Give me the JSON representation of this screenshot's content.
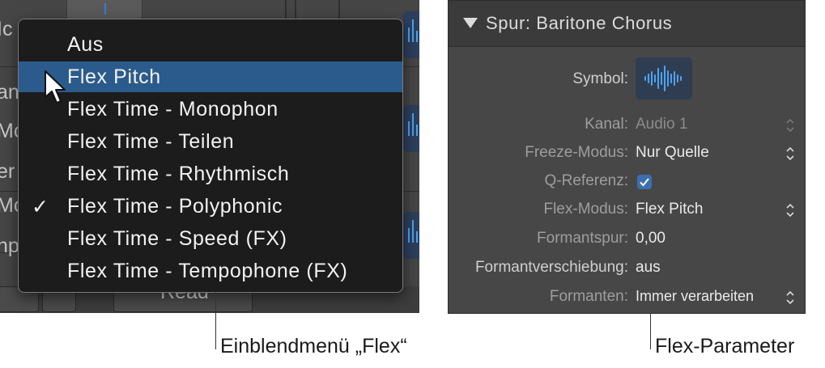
{
  "background_labels": [
    "Ic",
    "an",
    "Mc",
    "er",
    "Mc",
    "np"
  ],
  "background_read": "Read",
  "flex_menu": {
    "items": [
      {
        "label": "Aus",
        "checked": false,
        "selected": false
      },
      {
        "label": "Flex Pitch",
        "checked": false,
        "selected": true
      },
      {
        "label": "Flex Time - Monophon",
        "checked": false,
        "selected": false
      },
      {
        "label": "Flex Time - Teilen",
        "checked": false,
        "selected": false
      },
      {
        "label": "Flex Time - Rhythmisch",
        "checked": false,
        "selected": false
      },
      {
        "label": "Flex Time - Polyphonic",
        "checked": true,
        "selected": false
      },
      {
        "label": "Flex Time - Speed (FX)",
        "checked": false,
        "selected": false
      },
      {
        "label": "Flex Time - Tempophone (FX)",
        "checked": false,
        "selected": false
      }
    ],
    "checkmark": "✓"
  },
  "inspector": {
    "header": "Spur:  Baritone Chorus",
    "symbol_label": "Symbol:",
    "rows": [
      {
        "label": "Kanal:",
        "value": "Audio 1",
        "dim": true,
        "stepper": true
      },
      {
        "label": "Freeze-Modus:",
        "value": "Nur Quelle",
        "dim": false,
        "stepper": true
      },
      {
        "label": "Q-Referenz:",
        "value": "",
        "dim": false,
        "stepper": false,
        "checkbox": true
      },
      {
        "label": "Flex-Modus:",
        "value": "Flex Pitch",
        "dim": false,
        "stepper": true
      },
      {
        "label": "Formantspur:",
        "value": "0,00",
        "dim": false,
        "stepper": false
      },
      {
        "label": "Formantverschiebung:",
        "value": "aus",
        "dim": false,
        "stepper": false
      },
      {
        "label": "Formanten:",
        "value": "Immer verarbeiten",
        "dim": false,
        "stepper": true
      }
    ]
  },
  "callouts": {
    "left": "Einblendmenü „Flex“",
    "right": "Flex-Parameter"
  },
  "colors": {
    "selection": "#2b5b8c",
    "waveform": "#4ba3f2",
    "checkbox": "#3c6fae"
  }
}
